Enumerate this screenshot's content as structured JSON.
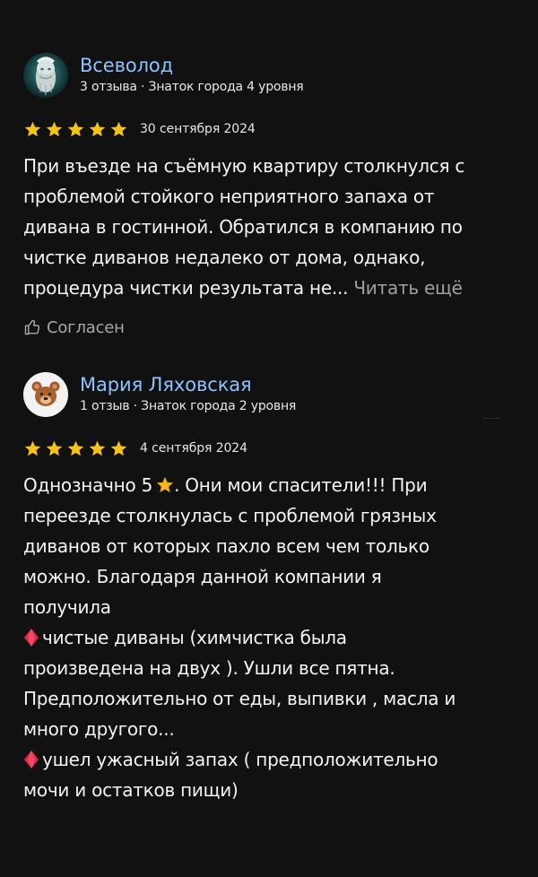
{
  "colors": {
    "background": "#111111",
    "name_link": "#8ec2ff",
    "star": "#f5c218",
    "muted": "#a0a0a0",
    "gem": "#e0294a"
  },
  "reviews": [
    {
      "author": "Всеволод",
      "stats": "3 отзыва · Знаток города 4 уровня",
      "avatar_icon": "statue-avatar-icon",
      "rating": 5,
      "date": "30 сентября 2024",
      "lines": [
        "При въезде на съёмную квартиру столкнулся с",
        "проблемой стойкого неприятного запаха от",
        "дивана в гостинной. Обратился в компанию по",
        "чистке диванов недалеко от дома, однако,",
        "процедура чистки результата не..."
      ],
      "read_more": "Читать ещё",
      "agree_label": "Согласен"
    },
    {
      "author": "Мария Ляховская",
      "stats": "1 отзыв · Знаток города 2 уровня",
      "avatar_icon": "bear-avatar-icon",
      "rating": 5,
      "date": "4 сентября 2024",
      "lines": [
        "Однозначно 5",
        ". Они мои спасители!!! При",
        "переезде столкнулась с проблемой грязных",
        "диванов от которых пахло всем чем только",
        "можно. Благодаря данной компании я",
        "получила",
        "чистые диваны (химчистка была",
        "произведена на двух ). Ушли все пятна.",
        "Предположительно от еды, выпивки , масла и",
        "много другого...",
        "ушел ужасный запах ( предположительно",
        "мочи и остатков пищи)"
      ]
    }
  ]
}
